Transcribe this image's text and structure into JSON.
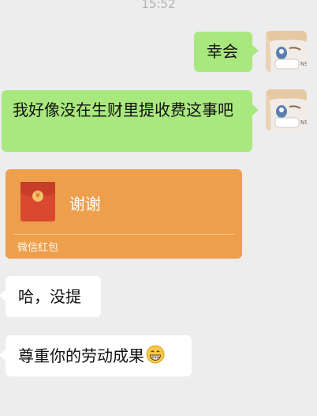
{
  "timestamp": "15:52",
  "messages": {
    "m1": {
      "text": "幸会"
    },
    "m2": {
      "text": "我好像没在生财里提收费这事吧"
    },
    "red_packet": {
      "title": "谢谢",
      "caption": "微信红包",
      "coin": "¥"
    },
    "m3": {
      "text": "哈，没提"
    },
    "m4": {
      "text": "尊重你的劳动成果",
      "emoji": "grinning-face-icon"
    }
  },
  "colors": {
    "background": "#ededed",
    "outgoing_bubble": "#a9e87e",
    "incoming_bubble": "#ffffff",
    "red_packet": "#ed9f4c"
  }
}
